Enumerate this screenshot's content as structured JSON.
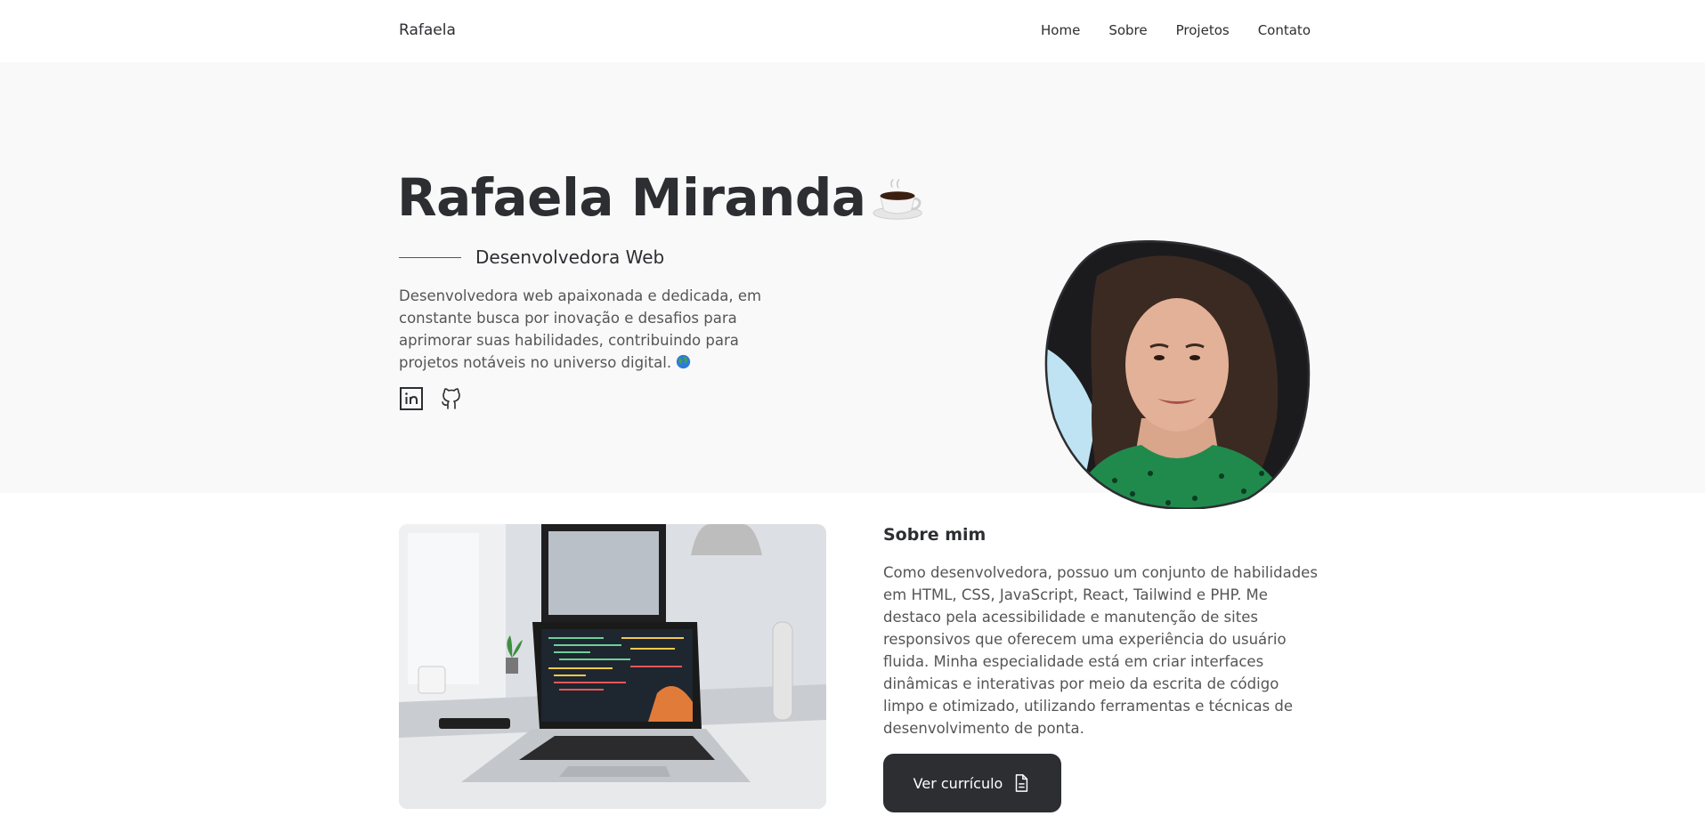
{
  "nav": {
    "brand": "Rafaela",
    "links": [
      "Home",
      "Sobre",
      "Projetos",
      "Contato"
    ]
  },
  "hero": {
    "name": "Rafaela Miranda",
    "name_emoji": "coffee-icon",
    "role": "Desenvolvedora Web",
    "description": "Desenvolvedora web apaixonada e dedicada, em constante busca por inovação e desafios para aprimorar suas habilidades, contribuindo para projetos notáveis no universo digital.",
    "description_emoji": "globe-icon",
    "socials": [
      "linkedin-icon",
      "github-icon"
    ],
    "background": "#f9f9f9"
  },
  "about": {
    "title": "Sobre mim",
    "text": "Como desenvolvedora, possuo um conjunto de habilidades em HTML, CSS, JavaScript, React, Tailwind e PHP. Me destaco pela acessibilidade e manutenção de sites responsivos que oferecem uma experiência do usuário fluida. Minha especialidade está em criar interfaces dinâmicas e interativas por meio da escrita de código limpo e otimizado, utilizando ferramentas e técnicas de desenvolvimento de ponta.",
    "cv_button": "Ver currículo",
    "cv_icon": "document-icon"
  },
  "colors": {
    "text": "#2d2e32",
    "muted": "#555555",
    "button_bg": "#2d2e32"
  }
}
